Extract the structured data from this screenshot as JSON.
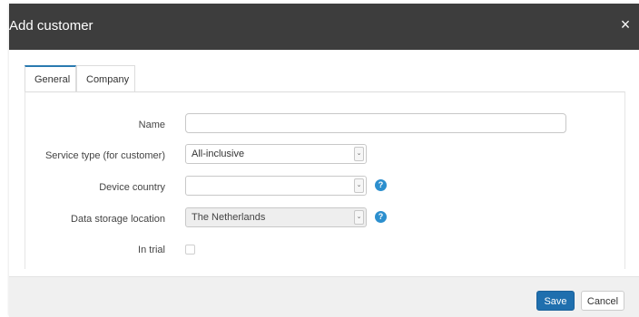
{
  "dialog": {
    "title": "Add customer",
    "close_symbol": "×"
  },
  "tabs": [
    {
      "label": "General",
      "active": true
    },
    {
      "label": "Company",
      "active": false
    }
  ],
  "form": {
    "name": {
      "label": "Name",
      "value": ""
    },
    "service_type": {
      "label": "Service type (for customer)",
      "value": "All-inclusive"
    },
    "device_country": {
      "label": "Device country",
      "value": ""
    },
    "data_storage": {
      "label": "Data storage location",
      "value": "The Netherlands",
      "disabled": true
    },
    "in_trial": {
      "label": "In trial",
      "checked": false
    },
    "help_symbol": "?",
    "arrow_symbol": "⌄"
  },
  "footer": {
    "save_label": "Save",
    "cancel_label": "Cancel"
  },
  "colors": {
    "titlebar": "#3d3d3d",
    "primary_button": "#1f6fae",
    "help_icon": "#2c8fce",
    "active_tab_border": "#2a7ab0"
  }
}
